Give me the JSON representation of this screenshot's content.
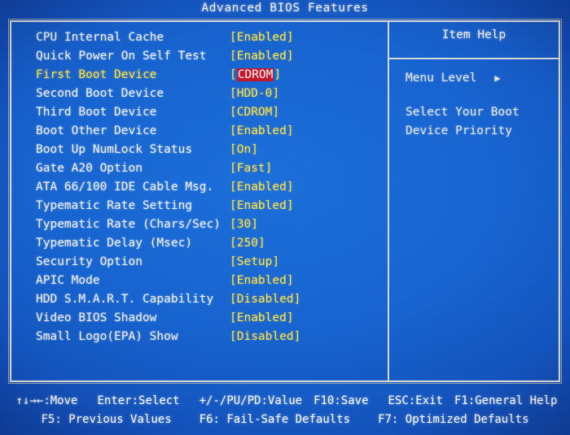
{
  "screen": {
    "title": "Advanced BIOS Features",
    "colors": {
      "background_blue": "#1563d2",
      "outer_blue": "#0b2f8f",
      "border_gray": "#d8dadd",
      "value_yellow": "#ffe54a",
      "label_white": "#f4f4f4",
      "selected_highlight_red": "#c8142a"
    }
  },
  "options": [
    {
      "label": "CPU Internal Cache",
      "open": "[",
      "value": "Enabled",
      "close": "]",
      "selected": false
    },
    {
      "label": "Quick Power On Self Test",
      "open": "[",
      "value": "Enabled",
      "close": "]",
      "selected": false
    },
    {
      "label": "First Boot Device",
      "open": "[",
      "value": "CDROM",
      "close": "]",
      "selected": true
    },
    {
      "label": "Second Boot Device",
      "open": "[",
      "value": "HDD-0",
      "close": "]",
      "selected": false
    },
    {
      "label": "Third Boot Device",
      "open": "[",
      "value": "CDROM",
      "close": "]",
      "selected": false
    },
    {
      "label": "Boot Other Device",
      "open": "[",
      "value": "Enabled",
      "close": "]",
      "selected": false
    },
    {
      "label": "Boot Up NumLock Status",
      "open": "[",
      "value": "On",
      "close": "]",
      "selected": false
    },
    {
      "label": "Gate A20 Option",
      "open": "[",
      "value": "Fast",
      "close": "]",
      "selected": false
    },
    {
      "label": "ATA 66/100 IDE Cable Msg.",
      "open": "[",
      "value": "Enabled",
      "close": "]",
      "selected": false
    },
    {
      "label": "Typematic Rate Setting",
      "open": "[",
      "value": "Enabled",
      "close": "]",
      "selected": false
    },
    {
      "label": "Typematic Rate (Chars/Sec)",
      "open": "[",
      "value": "30",
      "close": "]",
      "selected": false
    },
    {
      "label": "Typematic Delay (Msec)",
      "open": "[",
      "value": "250",
      "close": "]",
      "selected": false
    },
    {
      "label": "Security Option",
      "open": "[",
      "value": "Setup",
      "close": "]",
      "selected": false
    },
    {
      "label": "APIC Mode",
      "open": "[",
      "value": "Enabled",
      "close": "]",
      "selected": false
    },
    {
      "label": "HDD S.M.A.R.T. Capability",
      "open": "[",
      "value": "Disabled",
      "close": "]",
      "selected": false
    },
    {
      "label": "Video BIOS Shadow",
      "open": "[",
      "value": "Enabled",
      "close": "]",
      "selected": false
    },
    {
      "label": "Small Logo(EPA) Show",
      "open": "[",
      "value": "Disabled",
      "close": "]",
      "selected": false
    }
  ],
  "item_help": {
    "title": "Item Help",
    "menu_level_label": "Menu Level",
    "menu_level_arrow": "▶",
    "description_line1": "Select Your Boot",
    "description_line2": "Device Priority"
  },
  "footer": {
    "line1": {
      "move": "↑↓→←:Move",
      "enter": "Enter:Select",
      "value": "+/-/PU/PD:Value",
      "save": "F10:Save",
      "exit": "ESC:Exit",
      "general_help": "F1:General Help"
    },
    "line2": {
      "previous": "F5: Previous Values",
      "failsafe": "F6: Fail-Safe Defaults",
      "optimized": "F7: Optimized Defaults"
    }
  }
}
